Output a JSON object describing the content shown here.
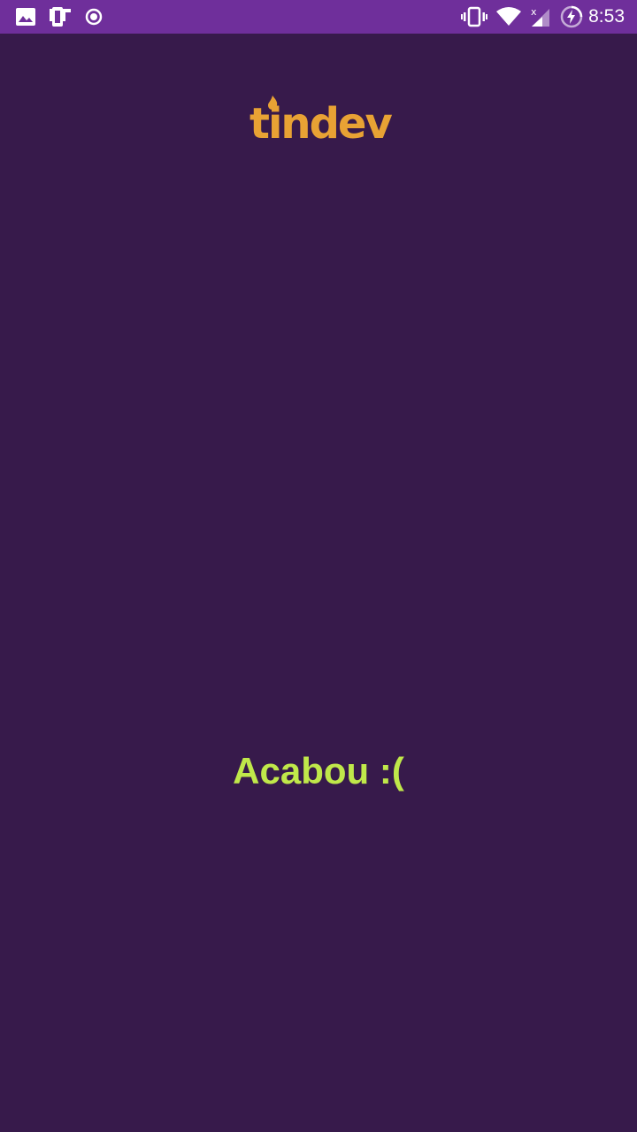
{
  "status_bar": {
    "time": "8:53",
    "left_icons": [
      "image-icon",
      "screenshot-icon",
      "record-icon"
    ],
    "right_icons": [
      "vibrate-icon",
      "wifi-icon",
      "signal-no-data-icon",
      "battery-charging-icon"
    ],
    "background": "#6f2f9b"
  },
  "app": {
    "logo_text": "tindev",
    "logo_color": "#e8a234",
    "background": "#371a4b",
    "empty_message": "Acabou :(",
    "empty_message_color": "#c0e84a"
  }
}
